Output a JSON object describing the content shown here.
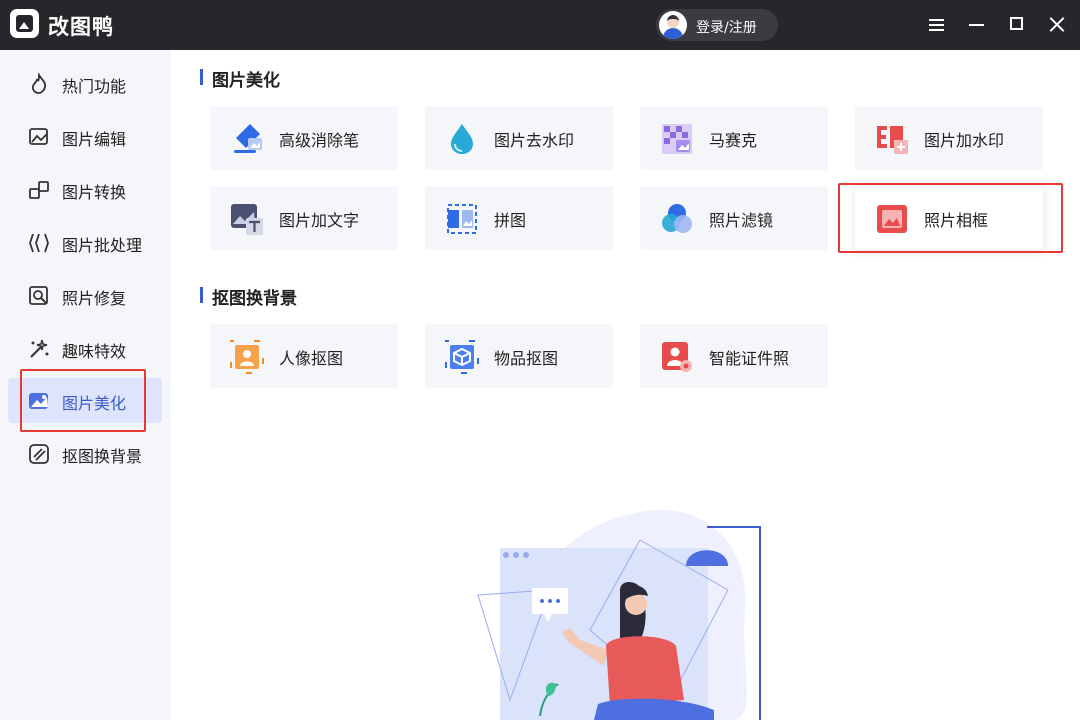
{
  "app": {
    "title": "改图鸭",
    "login_label": "登录/注册"
  },
  "sidebar": {
    "items": [
      {
        "label": "热门功能",
        "icon": "flame-icon",
        "active": false
      },
      {
        "label": "图片编辑",
        "icon": "image-edit-icon",
        "active": false
      },
      {
        "label": "图片转换",
        "icon": "convert-icon",
        "active": false
      },
      {
        "label": "图片批处理",
        "icon": "batch-icon",
        "active": false
      },
      {
        "label": "照片修复",
        "icon": "repair-icon",
        "active": false
      },
      {
        "label": "趣味特效",
        "icon": "sparkle-icon",
        "active": false
      },
      {
        "label": "图片美化",
        "icon": "beautify-icon",
        "active": true
      },
      {
        "label": "抠图换背景",
        "icon": "cutout-icon",
        "active": false
      }
    ]
  },
  "sections": [
    {
      "title": "图片美化",
      "cards": [
        {
          "label": "高级消除笔",
          "icon": "eraser-pen-icon"
        },
        {
          "label": "图片去水印",
          "icon": "water-drop-icon"
        },
        {
          "label": "马赛克",
          "icon": "mosaic-icon"
        },
        {
          "label": "图片加水印",
          "icon": "add-watermark-icon"
        },
        {
          "label": "图片加文字",
          "icon": "add-text-icon"
        },
        {
          "label": "拼图",
          "icon": "collage-icon"
        },
        {
          "label": "照片滤镜",
          "icon": "filter-icon"
        },
        {
          "label": "照片相框",
          "icon": "photo-frame-icon"
        }
      ]
    },
    {
      "title": "抠图换背景",
      "cards": [
        {
          "label": "人像抠图",
          "icon": "portrait-cutout-icon"
        },
        {
          "label": "物品抠图",
          "icon": "object-cutout-icon"
        },
        {
          "label": "智能证件照",
          "icon": "id-photo-icon"
        }
      ]
    }
  ],
  "colors": {
    "titlebar": "#26272b",
    "accent": "#3a5ccc",
    "highlight_box": "#e53935",
    "sidebar_bg": "#f5f6fa"
  }
}
